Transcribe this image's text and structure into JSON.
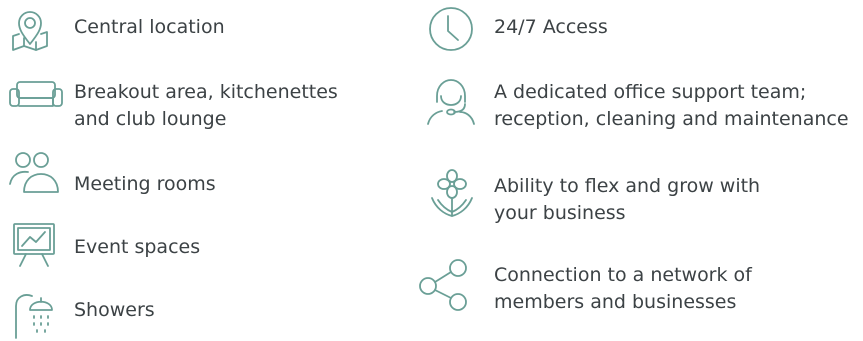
{
  "accent_color": "#6a9f96",
  "text_color": "#3c4245",
  "features_left": [
    {
      "icon": "location-map-icon",
      "lines": [
        "Central location"
      ]
    },
    {
      "icon": "sofa-icon",
      "lines": [
        "Breakout area, kitchenettes",
        "and club lounge"
      ]
    },
    {
      "icon": "people-icon",
      "lines": [
        "Meeting rooms"
      ]
    },
    {
      "icon": "presentation-board-icon",
      "lines": [
        "Event spaces"
      ]
    },
    {
      "icon": "shower-icon",
      "lines": [
        "Showers"
      ]
    }
  ],
  "features_right": [
    {
      "icon": "clock-icon",
      "lines": [
        "24/7 Access"
      ]
    },
    {
      "icon": "headset-support-icon",
      "lines": [
        "A dedicated office support team;",
        "reception, cleaning and maintenance"
      ]
    },
    {
      "icon": "flower-growth-icon",
      "lines": [
        "Ability to flex and grow with",
        "your business"
      ]
    },
    {
      "icon": "network-share-icon",
      "lines": [
        "Connection to a network of",
        "members and businesses"
      ]
    }
  ]
}
